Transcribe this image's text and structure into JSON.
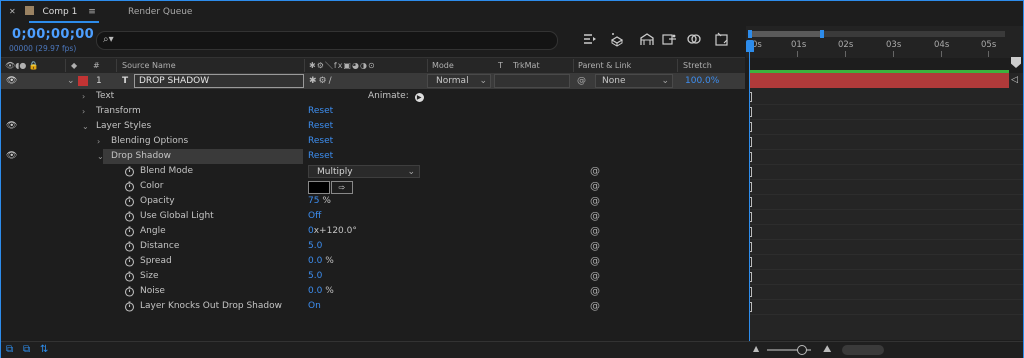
{
  "tabs": {
    "comp": "Comp 1",
    "render_queue": "Render Queue"
  },
  "timecode": "0;00;00;00",
  "fps_readout": "00000 (29.97 fps)",
  "search": {
    "placeholder": ""
  },
  "toolbar_icons": [
    "draft-3d-icon",
    "shy-layers-icon",
    "frame-blending-icon",
    "motion-blur-icon",
    "graph-editor-icon",
    "comp-flowchart-icon"
  ],
  "ruler": {
    "labels": [
      "0s",
      "01s",
      "02s",
      "03s",
      "04s",
      "05s"
    ]
  },
  "columns": {
    "source_name": "Source Name",
    "mode": "Mode",
    "t": "T",
    "trkmat": "TrkMat",
    "parent": "Parent & Link",
    "stretch": "Stretch",
    "index": "#"
  },
  "layer": {
    "number": "1",
    "type_glyph": "T",
    "name": "DROP SHADOW",
    "mode": "Normal",
    "parent": "None",
    "stretch": "100.0%",
    "label_color": "#c23434"
  },
  "properties": [
    {
      "label": "Text",
      "value": "",
      "indent": 0,
      "twirl": "closed",
      "stopwatch": false,
      "eye": false,
      "pickwhip": false
    },
    {
      "label": "Transform",
      "value": "Reset",
      "indent": 0,
      "twirl": "closed",
      "stopwatch": false,
      "eye": false,
      "pickwhip": false
    },
    {
      "label": "Layer Styles",
      "value": "Reset",
      "indent": 0,
      "twirl": "open",
      "stopwatch": false,
      "eye": true,
      "pickwhip": false
    },
    {
      "label": "Blending Options",
      "value": "Reset",
      "indent": 1,
      "twirl": "closed",
      "stopwatch": false,
      "eye": false,
      "pickwhip": false
    },
    {
      "label": "Drop Shadow",
      "value": "Reset",
      "indent": 1,
      "twirl": "open",
      "stopwatch": false,
      "eye": true,
      "pickwhip": false,
      "selected": true
    },
    {
      "label": "Blend Mode",
      "value": "Multiply",
      "indent": 2,
      "stopwatch": true,
      "pickwhip": true,
      "kind": "dropdown"
    },
    {
      "label": "Color",
      "value": "",
      "indent": 2,
      "stopwatch": true,
      "pickwhip": true,
      "kind": "color"
    },
    {
      "label": "Opacity",
      "value": "75",
      "unit": " %",
      "indent": 2,
      "stopwatch": true,
      "pickwhip": true
    },
    {
      "label": "Use Global Light",
      "value": "Off",
      "indent": 2,
      "stopwatch": true,
      "pickwhip": true
    },
    {
      "label": "Angle",
      "value": "0",
      "unit": "x+120.0°",
      "indent": 2,
      "stopwatch": true,
      "pickwhip": true
    },
    {
      "label": "Distance",
      "value": "5.0",
      "indent": 2,
      "stopwatch": true,
      "pickwhip": true
    },
    {
      "label": "Spread",
      "value": "0.0",
      "unit": " %",
      "indent": 2,
      "stopwatch": true,
      "pickwhip": true
    },
    {
      "label": "Size",
      "value": "5.0",
      "indent": 2,
      "stopwatch": true,
      "pickwhip": true
    },
    {
      "label": "Noise",
      "value": "0.0",
      "unit": " %",
      "indent": 2,
      "stopwatch": true,
      "pickwhip": true
    },
    {
      "label": "Layer Knocks Out Drop Shadow",
      "value": "On",
      "indent": 2,
      "stopwatch": true,
      "pickwhip": true
    }
  ],
  "animate_label": "Animate:",
  "colors": {
    "accent": "#2d8ceb",
    "value_blue": "#3d8ef0",
    "layer_bar": "#b03a3a",
    "layer_bar_top": "#3db23d"
  }
}
